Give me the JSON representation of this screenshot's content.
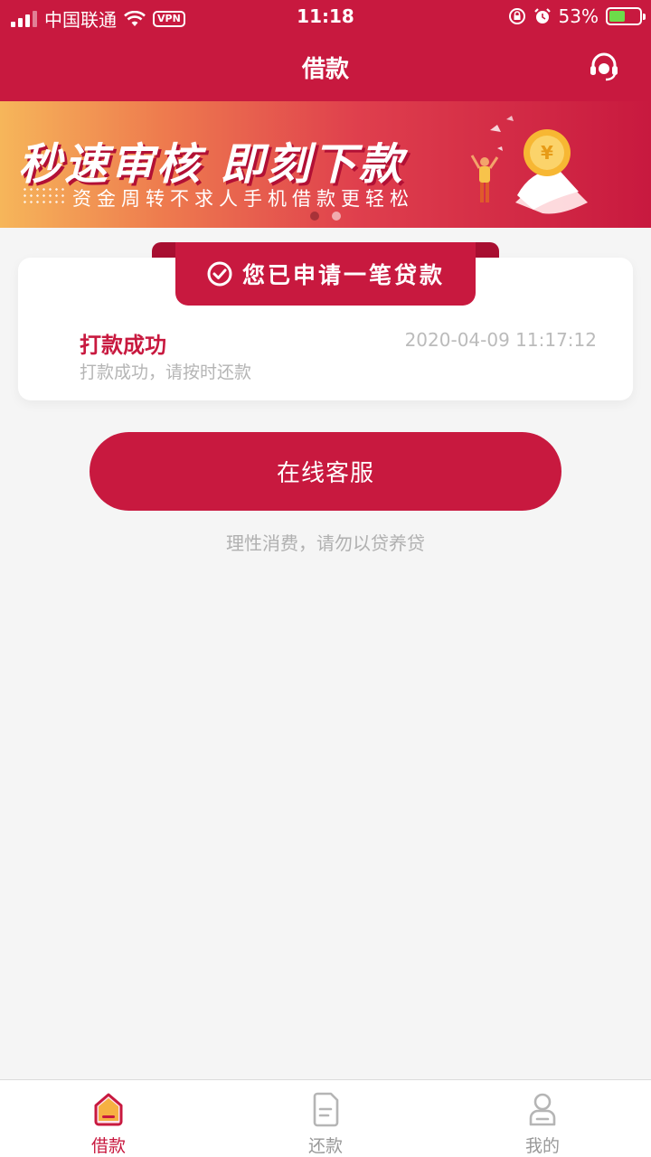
{
  "status_bar": {
    "carrier": "中国联通",
    "vpn": "VPN",
    "time": "11:18",
    "battery": "53%",
    "battery_level": 0.53
  },
  "header": {
    "title": "借款"
  },
  "banner": {
    "headline": "秒速审核 即刻下款",
    "subtitle": "资金周转不求人手机借款更轻松",
    "page_count": 2,
    "active_page": 1
  },
  "loan_card": {
    "ribbon_text": "您已申请一笔贷款",
    "status": "打款成功",
    "time": "2020-04-09 11:17:12",
    "description": "打款成功，请按时还款"
  },
  "actions": {
    "customer_service_label": "在线客服",
    "tip": "理性消费，请勿以贷养贷"
  },
  "tabs": [
    {
      "label": "借款",
      "icon": "home-icon",
      "active": true
    },
    {
      "label": "还款",
      "icon": "document-icon",
      "active": false
    },
    {
      "label": "我的",
      "icon": "user-icon",
      "active": false
    }
  ],
  "colors": {
    "primary": "#c8193f",
    "background": "#f5f5f5"
  }
}
